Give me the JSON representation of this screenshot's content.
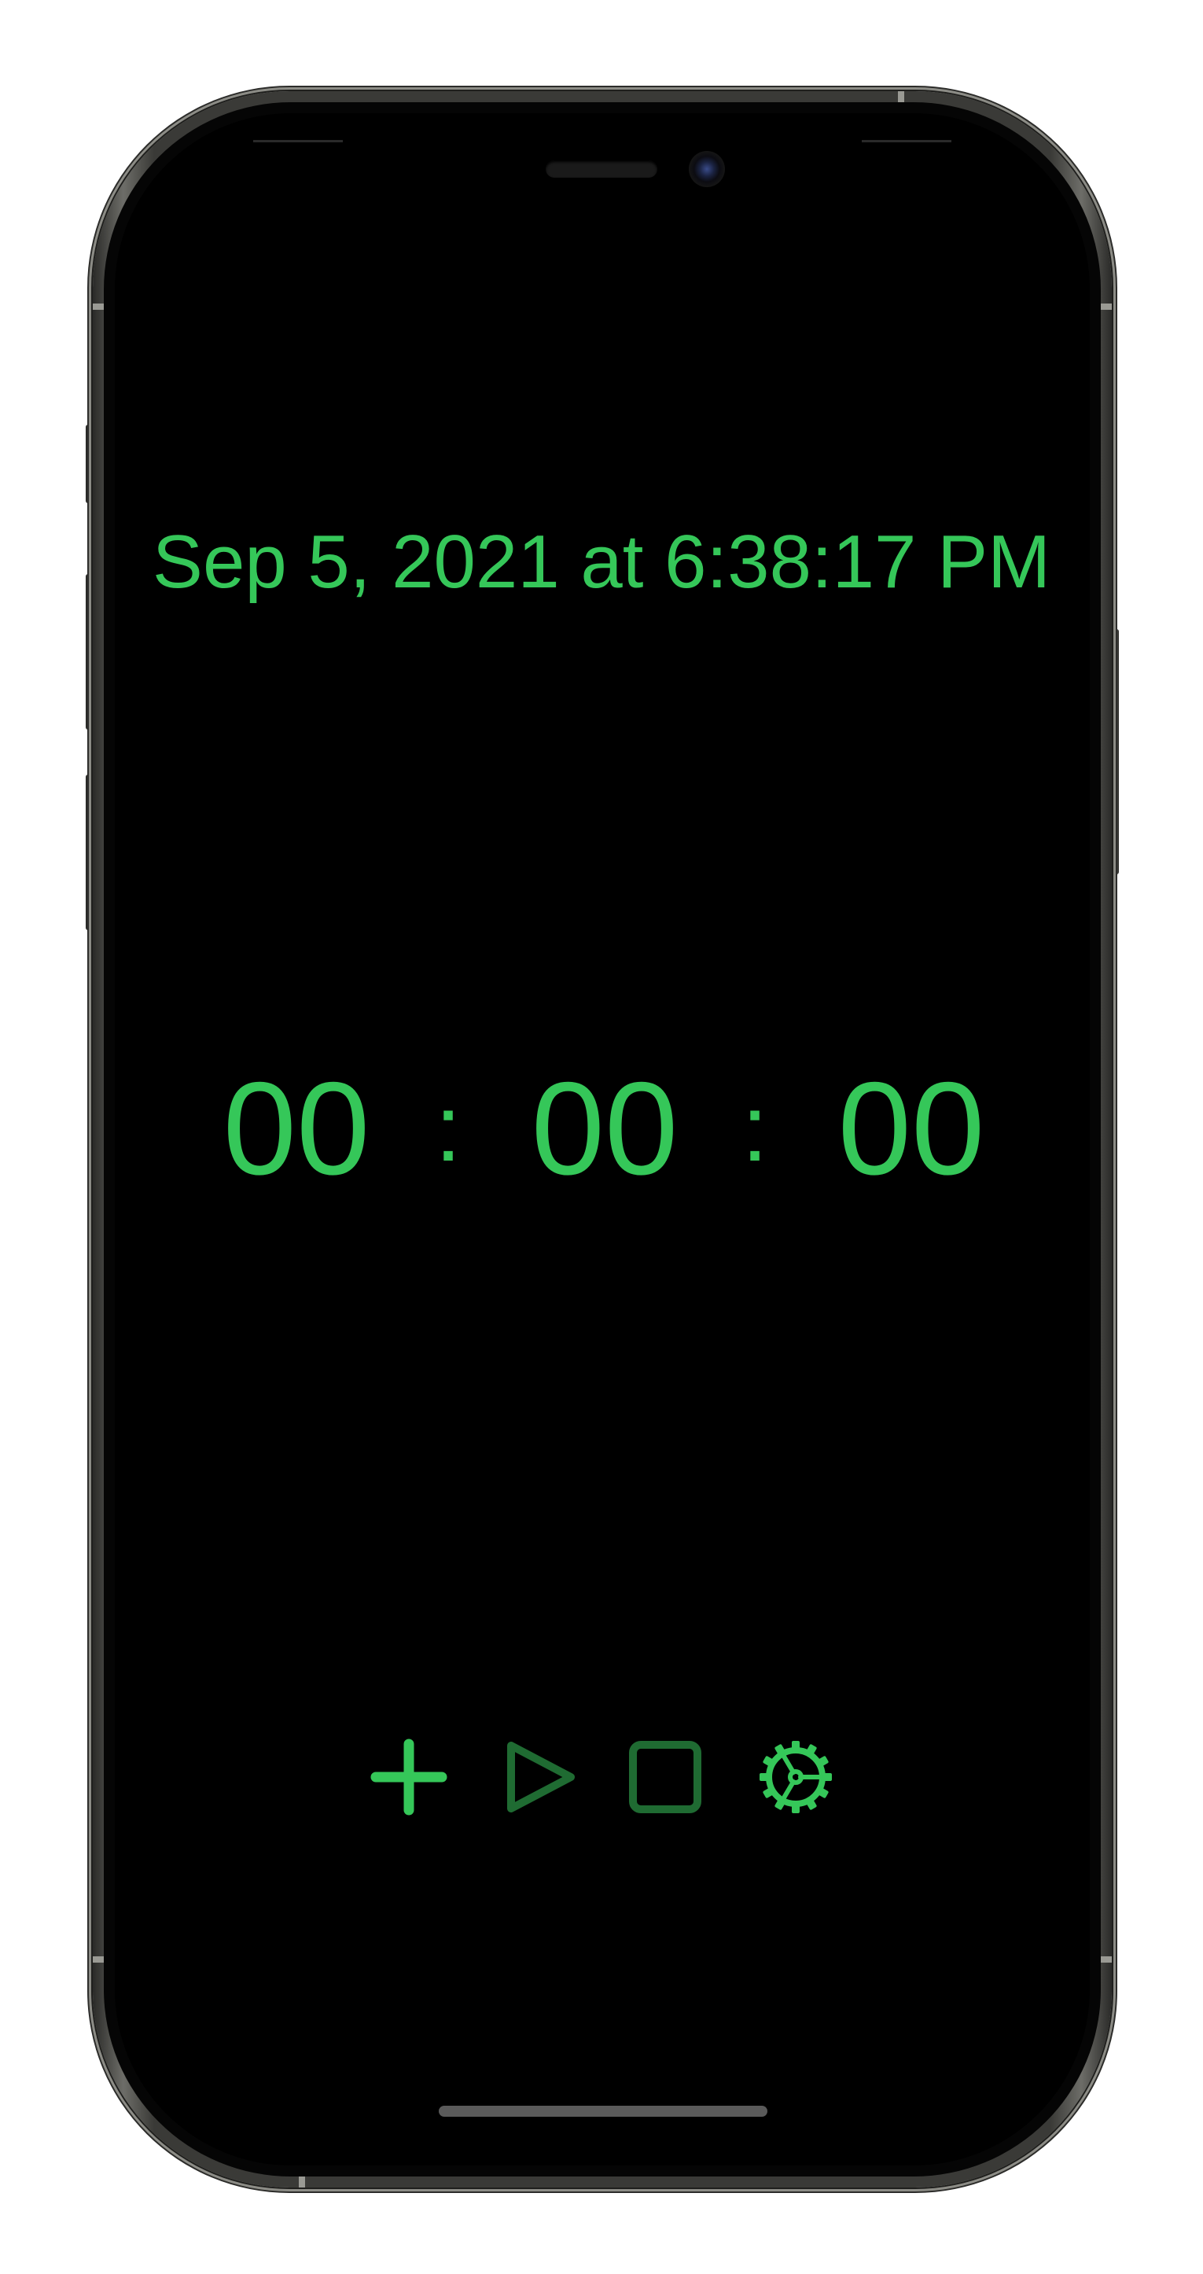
{
  "app": {
    "datetime": "Sep 5, 2021 at 6:38:17 PM"
  },
  "timer": {
    "hours": "00",
    "separator_1": ":",
    "minutes": "00",
    "separator_2": ":",
    "seconds": "00"
  },
  "controls": {
    "add_icon": "plus-icon",
    "play_icon": "play-icon",
    "stop_icon": "stop-icon",
    "settings_icon": "gear-icon",
    "play_enabled": false,
    "stop_enabled": false
  },
  "colors": {
    "accent": "#35c759",
    "accent_dim": "#1f6b32",
    "background": "#000000"
  }
}
